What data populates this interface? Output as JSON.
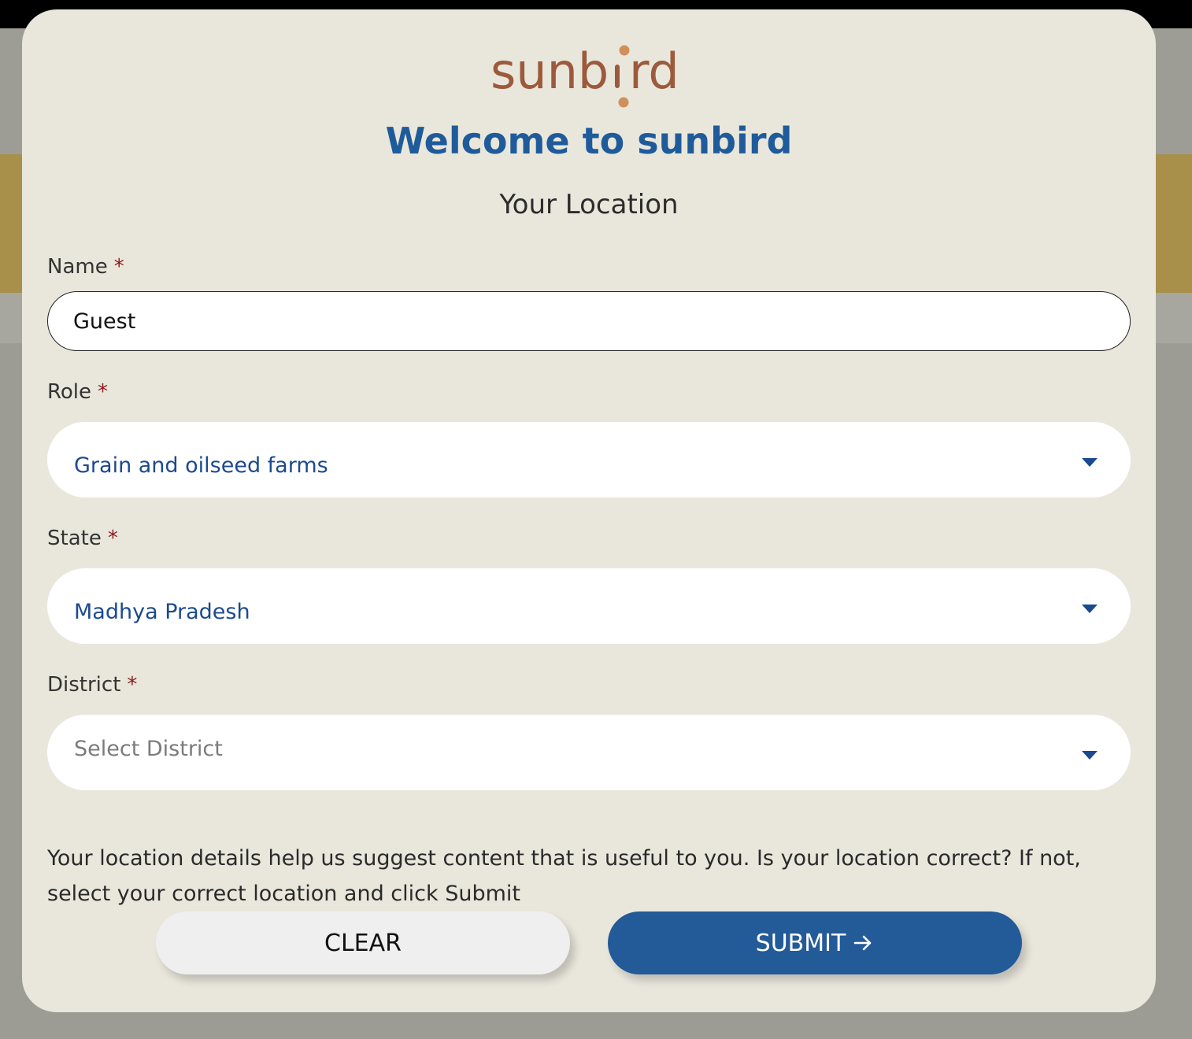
{
  "logo": {
    "text": "sunbird"
  },
  "modal": {
    "welcome": "Welcome to sunbird",
    "subtitle": "Your Location"
  },
  "form": {
    "required_marker": "*",
    "name": {
      "label": "Name",
      "value": "Guest"
    },
    "role": {
      "label": "Role",
      "value": "Grain and oilseed farms"
    },
    "state": {
      "label": "State",
      "value": "Madhya Pradesh"
    },
    "district": {
      "label": "District",
      "placeholder": "Select District"
    }
  },
  "info_text": "Your location details help us suggest content that is useful to you. Is your location correct? If not, select your correct location and click Submit",
  "buttons": {
    "clear": "CLEAR",
    "submit": "SUBMIT"
  },
  "icons": {
    "dropdown": "chevron-down-icon",
    "submit_arrow": "arrow-right-icon"
  },
  "colors": {
    "brand_logo": "#9c5a3c",
    "logo_dot": "#d0905a",
    "title_blue": "#1f5b9a",
    "select_value": "#1b4a8f",
    "submit_bg": "#235a98",
    "required": "#8a1a1a",
    "modal_bg": "#e9e7dc"
  }
}
